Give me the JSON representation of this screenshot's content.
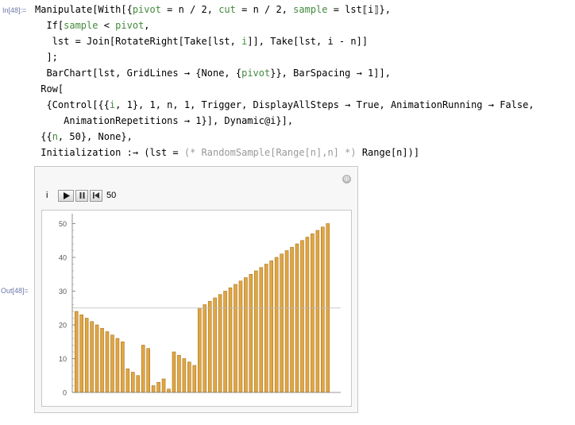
{
  "in_label": "In[48]:=",
  "out_label": "Out[48]=",
  "code": {
    "l1": [
      {
        "t": "Manipulate[With[{"
      },
      {
        "t": "pivot",
        "s": "v"
      },
      {
        "t": " = n / 2, "
      },
      {
        "t": "cut",
        "s": "v"
      },
      {
        "t": " = n / 2, "
      },
      {
        "t": "sample",
        "s": "v"
      },
      {
        "t": " = lst⟦i⟧},"
      }
    ],
    "l2": [
      {
        "t": "  If["
      },
      {
        "t": "sample",
        "s": "v"
      },
      {
        "t": " < "
      },
      {
        "t": "pivot",
        "s": "v"
      },
      {
        "t": ","
      }
    ],
    "l3": [
      {
        "t": "   lst = Join[RotateRight[Take[lst, "
      },
      {
        "t": "i",
        "s": "v"
      },
      {
        "t": "]], Take[lst, i - n]]"
      }
    ],
    "l4": [
      {
        "t": "  ];"
      }
    ],
    "l5": [
      {
        "t": "  BarChart[lst, GridLines → {None, {"
      },
      {
        "t": "pivot",
        "s": "v"
      },
      {
        "t": "}}, BarSpacing → 1]],"
      }
    ],
    "l6": [
      {
        "t": " Row["
      }
    ],
    "l7": [
      {
        "t": "  {Control[{{"
      },
      {
        "t": "i",
        "s": "v"
      },
      {
        "t": ", 1}, 1, n, 1, Trigger, DisplayAllSteps → True, AnimationRunning → False,"
      }
    ],
    "l8": [
      {
        "t": "     AnimationRepetitions → 1}], Dynamic@i}],"
      }
    ],
    "l9": [
      {
        "t": " {{"
      },
      {
        "t": "n",
        "s": "v"
      },
      {
        "t": ", 50}, None},"
      }
    ],
    "l10": [
      {
        "t": " Initialization :→ (lst = "
      },
      {
        "t": "(* RandomSample[Range[n],n] *)",
        "s": "c"
      },
      {
        "t": " Range[n])]"
      }
    ]
  },
  "manipulate": {
    "add_icon": "⊕",
    "control_label": "i",
    "play_icon": "play-icon",
    "pause_icon": "pause-icon",
    "reset_icon": "step-back-icon",
    "control_value": "50"
  },
  "chart_data": {
    "type": "bar",
    "ylim": [
      0,
      52
    ],
    "y_ticks": [
      0,
      10,
      20,
      30,
      40,
      50
    ],
    "gridline_y": 25,
    "bar_color": "#e0a643",
    "bar_edge": "#a9741d",
    "values": [
      24,
      23,
      22,
      21,
      20,
      19,
      18,
      17,
      16,
      15,
      7,
      6,
      5,
      14,
      13,
      2,
      3,
      4,
      1,
      12,
      11,
      10,
      9,
      8,
      25,
      26,
      27,
      28,
      29,
      30,
      31,
      32,
      33,
      34,
      35,
      36,
      37,
      38,
      39,
      40,
      41,
      42,
      43,
      44,
      45,
      46,
      47,
      48,
      49,
      50
    ]
  }
}
